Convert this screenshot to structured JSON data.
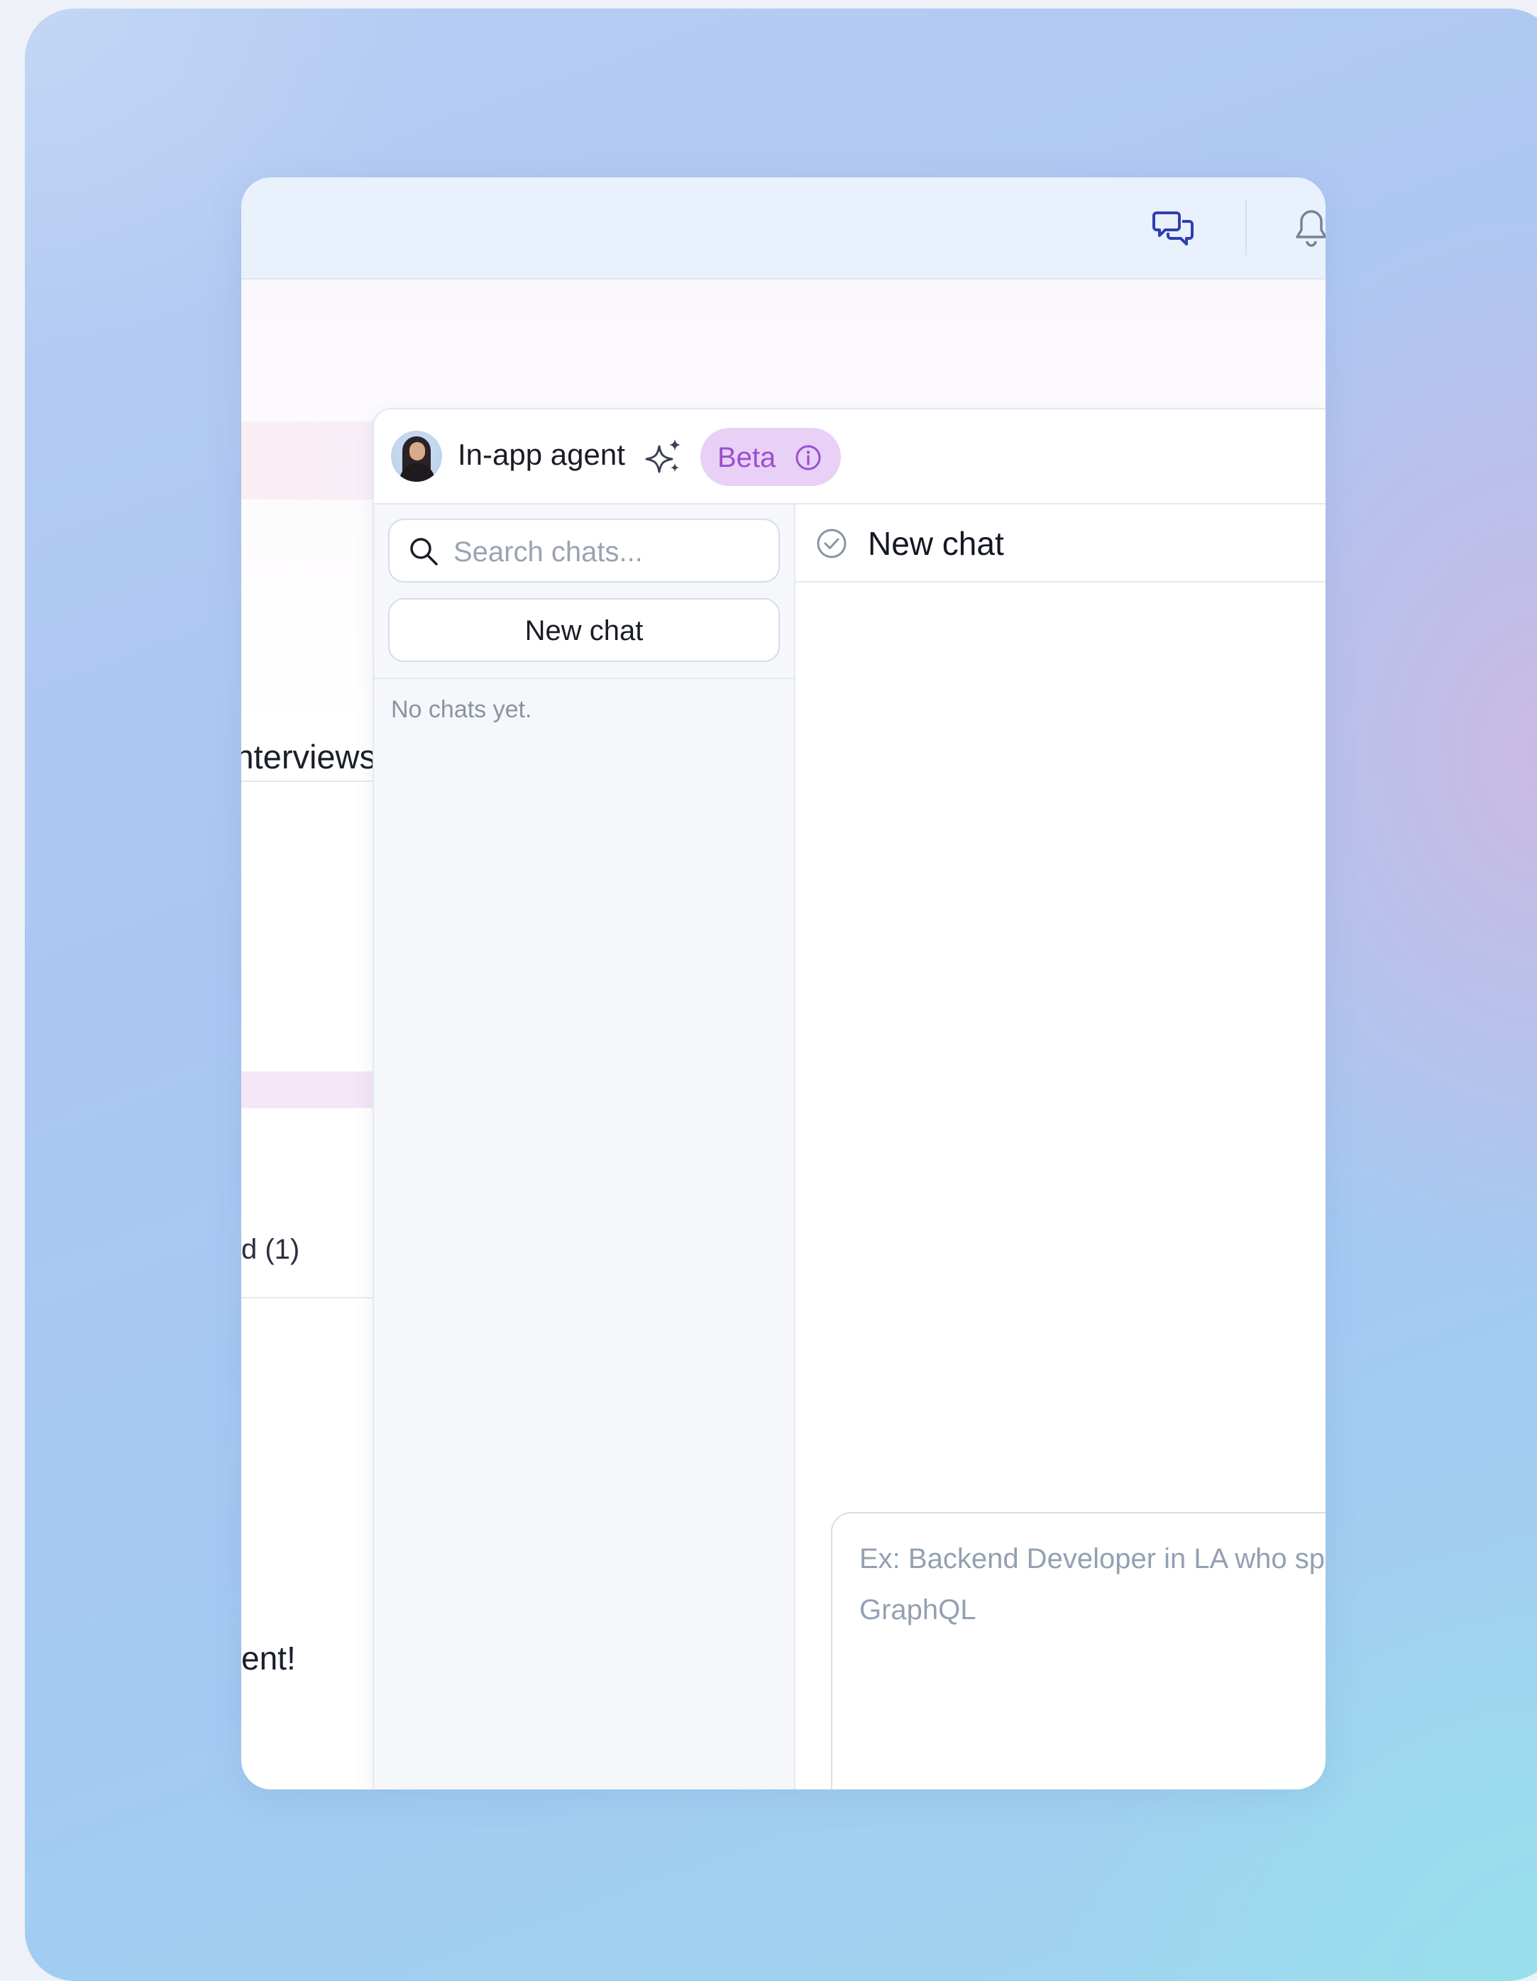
{
  "topbar": {
    "icons": [
      "chat-bubbles-icon",
      "bell-icon"
    ]
  },
  "background_page": {
    "partial_texts": [
      "nterviews",
      "d (1)",
      "ent!"
    ]
  },
  "agent_panel": {
    "title": "In-app agent",
    "badge": "Beta",
    "icons": [
      "avatar",
      "sparkle-icon",
      "info-icon"
    ]
  },
  "sidebar": {
    "search_placeholder": "Search chats...",
    "new_chat_label": "New chat",
    "empty_text": "No chats yet."
  },
  "chat": {
    "title": "New chat",
    "composer_placeholder": "Ex: Backend Developer in LA who speaks GraphQL"
  },
  "colors": {
    "accent": "#2f3fb0",
    "beta_badge_bg": "#e8d0f6",
    "beta_badge_text": "#9b4fcf",
    "topbar_bg": "#e9f1fc"
  }
}
